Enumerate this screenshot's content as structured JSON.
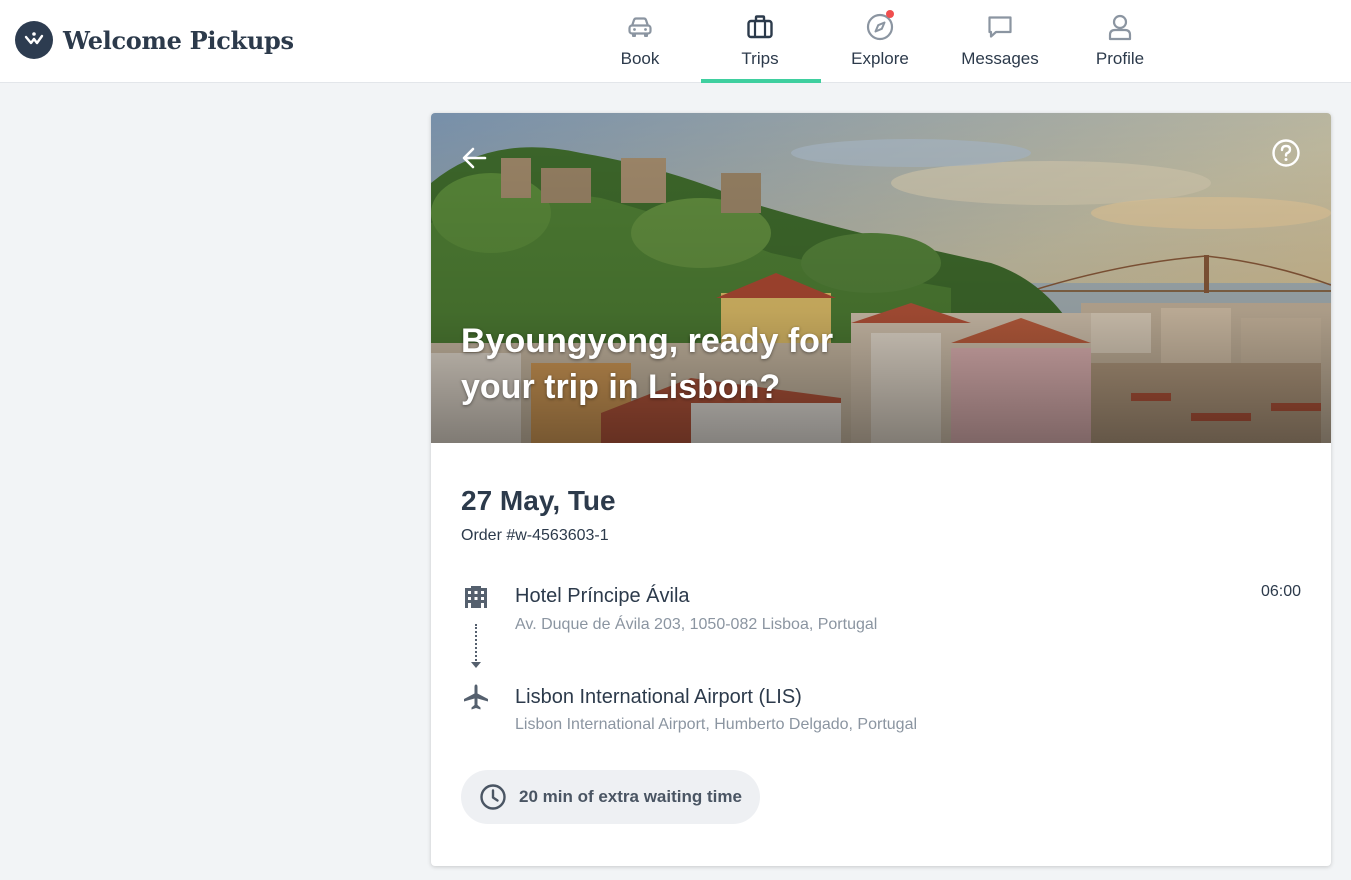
{
  "brand": {
    "name": "Welcome Pickups",
    "logo_icon": "welcome-pickups-logo"
  },
  "nav": {
    "items": [
      {
        "label": "Book",
        "icon": "car-icon",
        "active": false
      },
      {
        "label": "Trips",
        "icon": "briefcase-icon",
        "active": true
      },
      {
        "label": "Explore",
        "icon": "compass-icon",
        "active": false,
        "has_notification": true
      },
      {
        "label": "Messages",
        "icon": "chat-icon",
        "active": false
      },
      {
        "label": "Profile",
        "icon": "user-icon",
        "active": false
      }
    ],
    "active_indicator_color": "#3fcf9f"
  },
  "trip": {
    "hero_title": "Byoungyong, ready for your trip in Lisbon?",
    "date": "27 May, Tue",
    "order": "Order #w-4563603-1",
    "pickup": {
      "name": "Hotel Príncipe Ávila",
      "address": "Av. Duque de Ávila 203, 1050-082 Lisboa, Portugal",
      "time": "06:00",
      "icon": "building-icon"
    },
    "dropoff": {
      "name": "Lisbon International Airport (LIS)",
      "address": "Lisbon International Airport, Humberto Delgado, Portugal",
      "icon": "airplane-icon"
    },
    "waiting_time": "20 min of extra waiting time"
  },
  "colors": {
    "text_primary": "#2c3a4b",
    "text_secondary": "#8b95a1",
    "accent": "#3fcf9f",
    "notification": "#f04e4e",
    "page_background": "#f2f4f6"
  }
}
